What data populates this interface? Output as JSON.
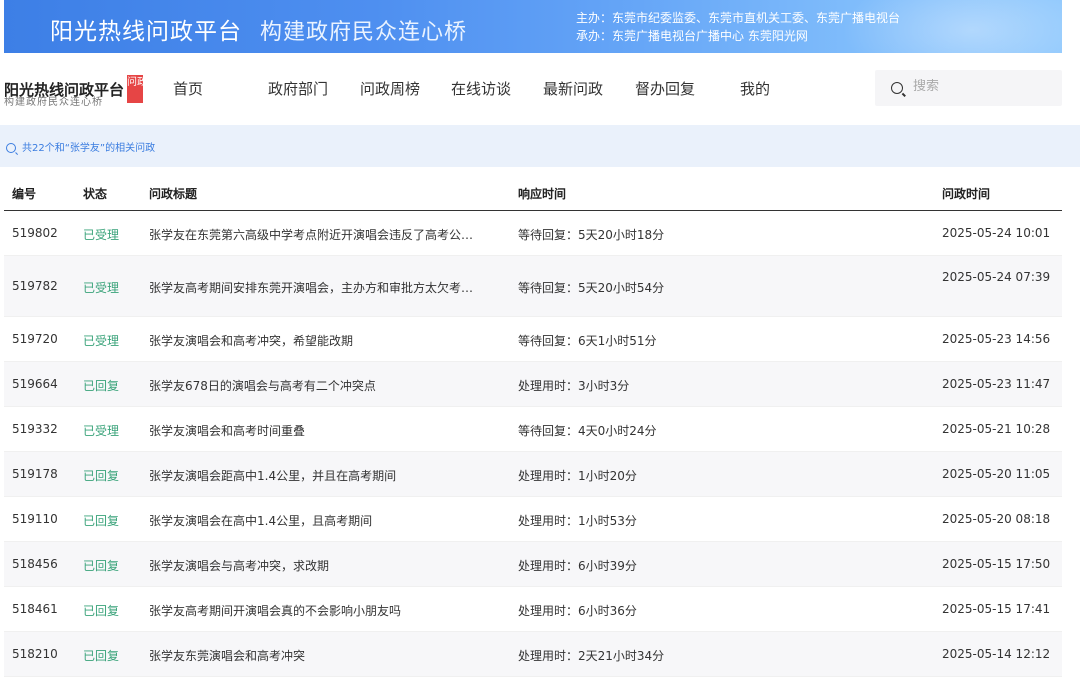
{
  "banner": {
    "title": "阳光热线问政平台",
    "slogan": "构建政府民众连心桥",
    "host_line": "主办：东莞市纪委监委、东莞市直机关工委、东莞广播电视台",
    "organizer_line": "承办：东莞广播电视台广播中心 东莞阳光网"
  },
  "logo": {
    "name": "阳光热线问政平台",
    "badge": "问政",
    "tagline": "构建政府民众连心桥"
  },
  "nav": {
    "items": [
      "首页",
      "政府部门",
      "问政周榜",
      "在线访谈",
      "最新问政",
      "督办回复",
      "我的"
    ]
  },
  "search": {
    "placeholder": "搜索"
  },
  "result": {
    "summary": "共22个和“张学友”的相关问政"
  },
  "table": {
    "headers": [
      "编号",
      "状态",
      "问政标题",
      "响应时间",
      "问政时间"
    ],
    "rows": [
      {
        "id": "519802",
        "status": "已受理",
        "title": "张学友在东莞第六高级中学考点附近开演唱会违反了高考公…",
        "response": "等待回复：5天20小时18分",
        "time": "2025-05-24 10:01"
      },
      {
        "id": "519782",
        "status": "已受理",
        "title": "张学友高考期间安排东莞开演唱会，主办方和审批方太欠考…",
        "response": "等待回复：5天20小时54分",
        "time": "2025-05-24 07:39"
      },
      {
        "id": "519720",
        "status": "已受理",
        "title": "张学友演唱会和高考冲突，希望能改期",
        "response": "等待回复：6天1小时51分",
        "time": "2025-05-23 14:56"
      },
      {
        "id": "519664",
        "status": "已回复",
        "title": "张学友678日的演唱会与高考有二个冲突点",
        "response": "处理用时：3小时3分",
        "time": "2025-05-23 11:47"
      },
      {
        "id": "519332",
        "status": "已受理",
        "title": "张学友演唱会和高考时间重叠",
        "response": "等待回复：4天0小时24分",
        "time": "2025-05-21 10:28"
      },
      {
        "id": "519178",
        "status": "已回复",
        "title": "张学友演唱会距高中1.4公里，并且在高考期间",
        "response": "处理用时：1小时20分",
        "time": "2025-05-20 11:05"
      },
      {
        "id": "519110",
        "status": "已回复",
        "title": "张学友演唱会在高中1.4公里，且高考期间",
        "response": "处理用时：1小时53分",
        "time": "2025-05-20 08:18"
      },
      {
        "id": "518456",
        "status": "已回复",
        "title": "张学友演唱会与高考冲突，求改期",
        "response": "处理用时：6小时39分",
        "time": "2025-05-15 17:50"
      },
      {
        "id": "518461",
        "status": "已回复",
        "title": "张学友高考期间开演唱会真的不会影响小朋友吗",
        "response": "处理用时：6小时36分",
        "time": "2025-05-15 17:41"
      },
      {
        "id": "518210",
        "status": "已回复",
        "title": "张学友东莞演唱会和高考冲突",
        "response": "处理用时：2天21小时34分",
        "time": "2025-05-14 12:12"
      }
    ]
  }
}
